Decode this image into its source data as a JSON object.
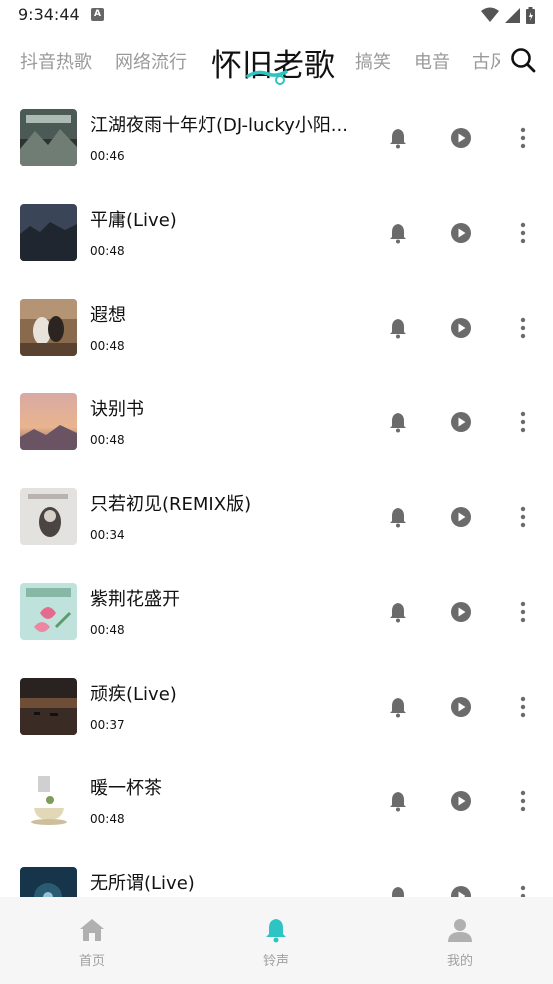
{
  "status_bar": {
    "time": "9:34:44",
    "notification_glyph": "A"
  },
  "tabs": [
    {
      "label": "抖音热歌",
      "active": false
    },
    {
      "label": "网络流行",
      "active": false
    },
    {
      "label": "怀旧老歌",
      "active": true
    },
    {
      "label": "搞笑",
      "active": false
    },
    {
      "label": "电音",
      "active": false
    },
    {
      "label": "古风",
      "active": false
    }
  ],
  "songs": [
    {
      "title": "江湖夜雨十年灯(DJ-lucky小阳...",
      "duration": "00:46"
    },
    {
      "title": "平庸(Live)",
      "duration": "00:48"
    },
    {
      "title": "遐想",
      "duration": "00:48"
    },
    {
      "title": "诀别书",
      "duration": "00:48"
    },
    {
      "title": "只若初见(REMIX版)",
      "duration": "00:34"
    },
    {
      "title": "紫荆花盛开",
      "duration": "00:48"
    },
    {
      "title": "顽疾(Live)",
      "duration": "00:37"
    },
    {
      "title": "暖一杯茶",
      "duration": "00:48"
    },
    {
      "title": "无所谓(Live)",
      "duration": ""
    }
  ],
  "bottom_nav": [
    {
      "label": "首页",
      "icon": "home-icon",
      "active": false
    },
    {
      "label": "铃声",
      "icon": "bell-icon",
      "active": true
    },
    {
      "label": "我的",
      "icon": "user-icon",
      "active": false
    }
  ],
  "colors": {
    "accent": "#2ec4c4",
    "icon_gray": "#6b6b6b",
    "tab_gray": "#9a9a9a",
    "nav_bg": "#f6f6f6"
  }
}
